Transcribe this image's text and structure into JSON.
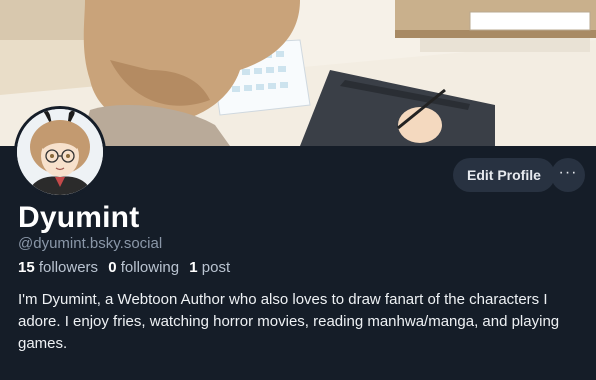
{
  "profile": {
    "display_name": "Dyumint",
    "handle": "@dyumint.bsky.social",
    "followers_count": "15",
    "followers_label": "followers",
    "following_count": "0",
    "following_label": "following",
    "posts_count": "1",
    "posts_label": "post",
    "bio": "I'm Dyumint, a Webtoon Author who also loves to draw fanart of the characters I adore. I enjoy fries, watching horror movies, reading manhwa/manga, and playing games."
  },
  "actions": {
    "edit_label": "Edit Profile",
    "more_label": "···"
  },
  "colors": {
    "background": "#151d28",
    "button_bg": "#283241",
    "muted_text": "#8a97a8"
  }
}
